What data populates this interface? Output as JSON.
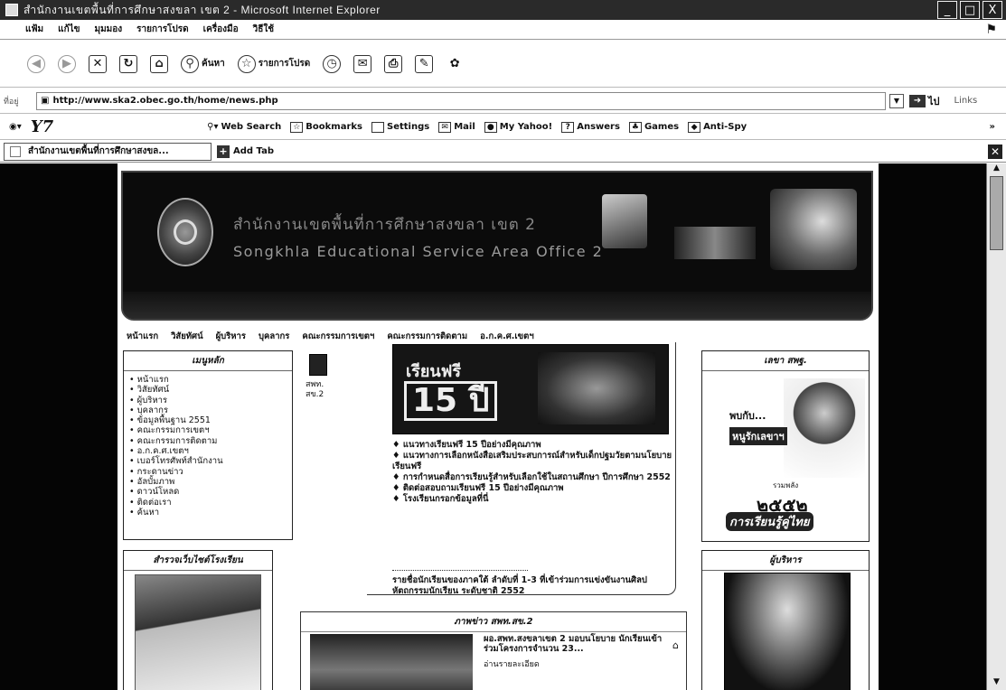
{
  "window": {
    "title": "สำนักงานเขตพื้นที่การศึกษาสงขลา เขต 2 - Microsoft Internet Explorer",
    "controls": [
      "_",
      "□",
      "X"
    ]
  },
  "menubar": [
    "แฟ้ม",
    "แก้ไข",
    "มุมมอง",
    "รายการโปรด",
    "เครื่องมือ",
    "วิธีใช้"
  ],
  "toolbar": {
    "search_label": "ค้นหา",
    "favorites_label": "รายการโปรด"
  },
  "address": {
    "label": "ที่อยู่",
    "url": "http://www.ska2.obec.go.th/home/news.php",
    "go_label": "ไป",
    "links_label": "Links"
  },
  "yahoo": {
    "logo": "Y7",
    "items": [
      "Web Search",
      "Bookmarks",
      "Settings",
      "Mail",
      "My Yahoo!",
      "Answers",
      "Games",
      "Anti-Spy"
    ]
  },
  "tabs": {
    "active": "สำนักงานเขตพื้นที่การศึกษาสงขล...",
    "add_label": "Add Tab"
  },
  "banner": {
    "title_th": "สำนักงานเขตพื้นที่การศึกษาสงขลา เขต 2",
    "title_en": "Songkhla Educational Service Area Office 2"
  },
  "nav": [
    "หน้าแรก",
    "วิสัยทัศน์",
    "ผู้บริหาร",
    "บุคลากร",
    "คณะกรรมการเขตฯ",
    "คณะกรรมการติดตาม",
    "อ.ก.ค.ศ.เขตฯ"
  ],
  "main_menu": {
    "heading": "เมนูหลัก",
    "items": [
      "หน้าแรก",
      "วิสัยทัศน์",
      "ผู้บริหาร",
      "บุคลากร",
      "ข้อมูลพื้นฐาน 2551",
      "คณะกรรมการเขตฯ",
      "คณะกรรมการติดตาม",
      "อ.ก.ค.ศ.เขตฯ",
      "เบอร์โทรศัพท์สำนักงาน",
      "กระดานข่าว",
      "อัลบั้มภาพ",
      "ดาวน์โหลด",
      "ติดต่อเรา",
      "ค้นหา"
    ]
  },
  "school_box": {
    "heading": "สำรวจเว็บไซต์โรงเรียน"
  },
  "avatar_caption": "สพท. สข.2",
  "promo": {
    "text": "เรียนฟรี",
    "number": "15 ปี"
  },
  "center_links": [
    "แนวทางเรียนฟรี 15 ปีอย่างมีคุณภาพ",
    "แนวทางการเลือกหนังสือเสริมประสบการณ์สำหรับเด็กปฐมวัยตามนโยบายเรียนฟรี",
    "การกำหนดสื่อการเรียนรู้สำหรับเลือกใช้ในสถานศึกษา ปีการศึกษา 2552",
    "ติดต่อสอบถามเรียนฟรี 15 ปีอย่างมีคุณภาพ",
    "โรงเรียนกรอกข้อมูลที่นี่"
  ],
  "award": "รายชื่อนักเรียนของภาคใต้ ลำดับที่ 1-3 ที่เข้าร่วมการแข่งขันงานศิลปหัตถกรรมนักเรียน ระดับชาติ 2552",
  "news": {
    "heading": "ภาพข่าว สพท.สข.2",
    "headline": "ผอ.สพท.สงขลาเขต 2 มอบนโยบาย นักเรียนเข้าร่วมโครงการจำนวน 23...",
    "more": "อ่านรายละเอียด"
  },
  "right_top": {
    "heading": "เลขา สพฐ.",
    "line1": "พบกับ...",
    "line2": "หนูรักเลขาฯ",
    "emblem_top": "รวมพลัง",
    "emblem_num": "๒๕๕๒",
    "emblem_sub": "การเรียนรู้คู่ไทย"
  },
  "right_bottom": {
    "heading": "ผู้บริหาร"
  }
}
